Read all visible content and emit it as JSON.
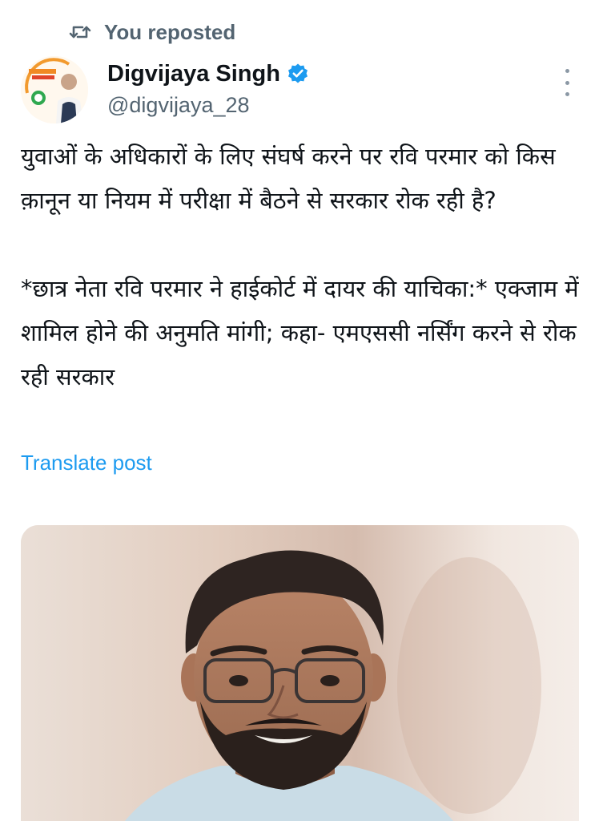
{
  "repost": {
    "icon": "repost-icon",
    "label": "You reposted"
  },
  "author": {
    "avatar_icon": "avatar",
    "name": "Digvijaya Singh",
    "verified_icon": "verified-badge-icon",
    "handle": "@digvijaya_28"
  },
  "menu": {
    "icon": "more-options-icon"
  },
  "post": {
    "paragraph_1": "युवाओं के अधिकारों के लिए संघर्ष करने पर रवि परमार को किस क़ानून या नियम में परीक्षा में बैठने से सरकार रोक रही है?",
    "paragraph_2": "*छात्र नेता रवि परमार ने हाईकोर्ट में दायर की याचिका:* एक्जाम में शामिल होने की अनुमति मांगी; कहा- एमएससी नर्सिंग करने से रोक रही सरकार"
  },
  "translate": {
    "label": "Translate post"
  },
  "media": {
    "description_icon": "photo-of-man-with-glasses"
  },
  "colors": {
    "text_primary": "#0f1419",
    "text_secondary": "#536471",
    "link": "#1d9bf0",
    "verified": "#1d9bf0"
  }
}
